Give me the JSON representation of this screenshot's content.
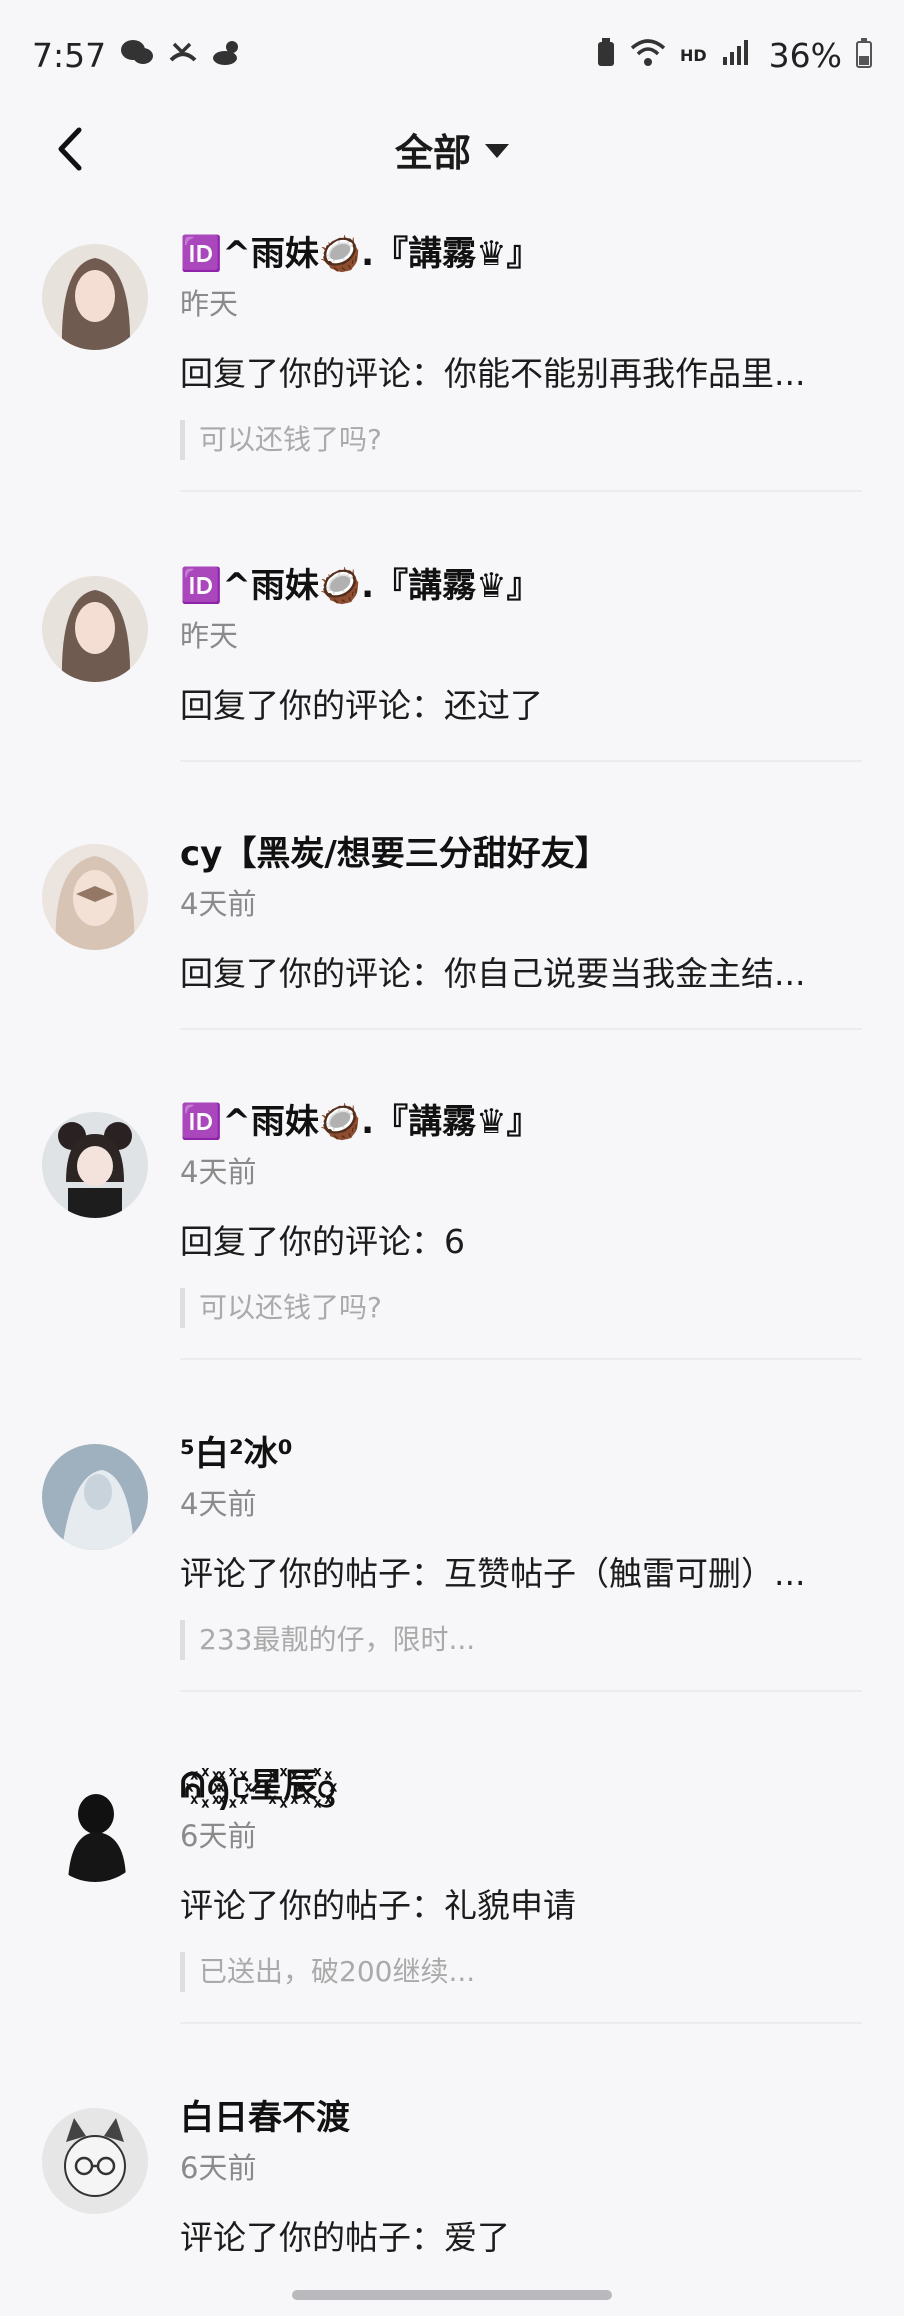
{
  "status": {
    "time": "7:57",
    "battery": "36%",
    "hd": "HD"
  },
  "header": {
    "title": "全部"
  },
  "items": [
    {
      "name": "🆔^雨妹🥥.『講霧♛』",
      "time": "昨天",
      "content": "回复了你的评论：你能不能别再我作品里...",
      "quote": "可以还钱了吗?"
    },
    {
      "name": "🆔^雨妹🥥.『講霧♛』",
      "time": "昨天",
      "content": "回复了你的评论：还过了",
      "quote": ""
    },
    {
      "name": "cy【黑炭/想要三分甜好友】",
      "time": "4天前",
      "content": "回复了你的评论：你自己说要当我金主结...",
      "quote": ""
    },
    {
      "name": "🆔^雨妹🥥.『講霧♛』",
      "time": "4天前",
      "content": "回复了你的评论：6",
      "quote": "可以还钱了吗?"
    },
    {
      "name": "⁵白²冰⁰",
      "time": "4天前",
      "content": "评论了你的帖子：互赞帖子（触雷可删）...",
      "quote": "233最靓的仔，限时..."
    },
    {
      "name": "ᕱ꙰ꪆ꙰ᥴ星꙰辰꙰ᦋ",
      "time": "6天前",
      "content": "评论了你的帖子：礼貌申请",
      "quote": "已送出，破200继续..."
    },
    {
      "name": "白日春不渡",
      "time": "6天前",
      "content": "评论了你的帖子：爱了",
      "quote": ""
    }
  ]
}
